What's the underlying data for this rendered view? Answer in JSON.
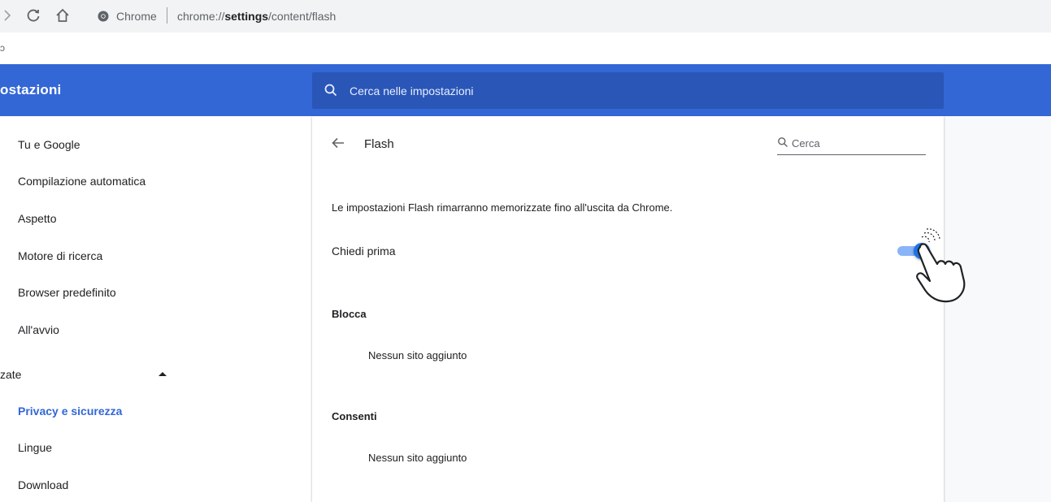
{
  "browser": {
    "site_name": "Chrome",
    "url_prefix": "chrome://",
    "url_bold": "settings",
    "url_suffix": "/content/flash",
    "bookmark_stub": "ↄ"
  },
  "header": {
    "title": "ostazioni",
    "search_placeholder": "Cerca nelle impostazioni"
  },
  "sidebar": {
    "items": [
      {
        "label": "Tu e Google"
      },
      {
        "label": "Compilazione automatica"
      },
      {
        "label": "Aspetto"
      },
      {
        "label": "Motore di ricerca"
      },
      {
        "label": "Browser predefinito"
      },
      {
        "label": "All'avvio"
      }
    ],
    "advanced_label": "zate",
    "advanced_items": [
      {
        "label": "Privacy e sicurezza",
        "active": true
      },
      {
        "label": "Lingue"
      },
      {
        "label": "Download"
      }
    ]
  },
  "content": {
    "title": "Flash",
    "search_placeholder": "Cerca",
    "info": "Le impostazioni Flash rimarranno memorizzate fino all'uscita da Chrome.",
    "ask_first_label": "Chiedi prima",
    "ask_first_enabled": true,
    "block_label": "Blocca",
    "block_empty": "Nessun sito aggiunto",
    "allow_label": "Consenti",
    "allow_empty": "Nessun sito aggiunto"
  },
  "colors": {
    "header_blue": "#3367d6",
    "search_blue": "#2a56b8",
    "toggle_on": "#1a73e8",
    "active_link": "#3367d6"
  },
  "icons": [
    "forward-icon",
    "reload-icon",
    "home-icon",
    "chrome-site-icon",
    "search-icon",
    "back-arrow-icon",
    "caret-up-icon",
    "pointer-hand-icon"
  ]
}
